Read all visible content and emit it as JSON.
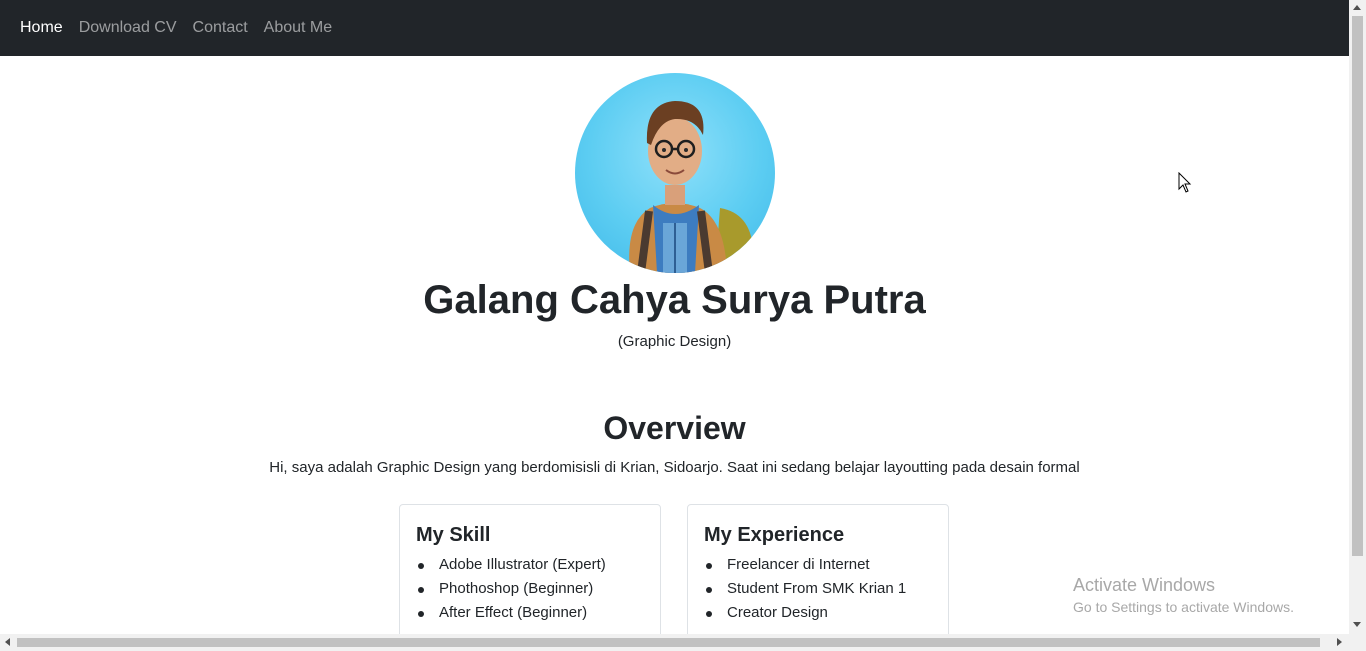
{
  "nav": {
    "items": [
      {
        "label": "Home",
        "active": true
      },
      {
        "label": "Download CV",
        "active": false
      },
      {
        "label": "Contact",
        "active": false
      },
      {
        "label": "About Me",
        "active": false
      }
    ]
  },
  "profile": {
    "name": "Galang Cahya Surya Putra",
    "role": "(Graphic Design)",
    "avatar_icon": "cartoon-man-with-glasses-and-backpack"
  },
  "overview": {
    "title": "Overview",
    "text": "Hi, saya adalah Graphic Design yang berdomisisli di Krian, Sidoarjo. Saat ini sedang belajar layoutting pada desain formal"
  },
  "skills": {
    "title": "My Skill",
    "items": [
      "Adobe Illustrator (Expert)",
      "Phothoshop (Beginner)",
      "After Effect (Beginner)"
    ]
  },
  "experience": {
    "title": "My Experience",
    "items": [
      "Freelancer di Internet",
      "Student From SMK Krian 1",
      "Creator Design"
    ]
  },
  "watermark": {
    "title": "Activate Windows",
    "subtitle": "Go to Settings to activate Windows."
  },
  "colors": {
    "navbar_bg": "#212529",
    "nav_active": "#ffffff",
    "nav_inactive": "#8e9196",
    "text": "#212529",
    "avatar_bg": "#5ccdf2"
  }
}
